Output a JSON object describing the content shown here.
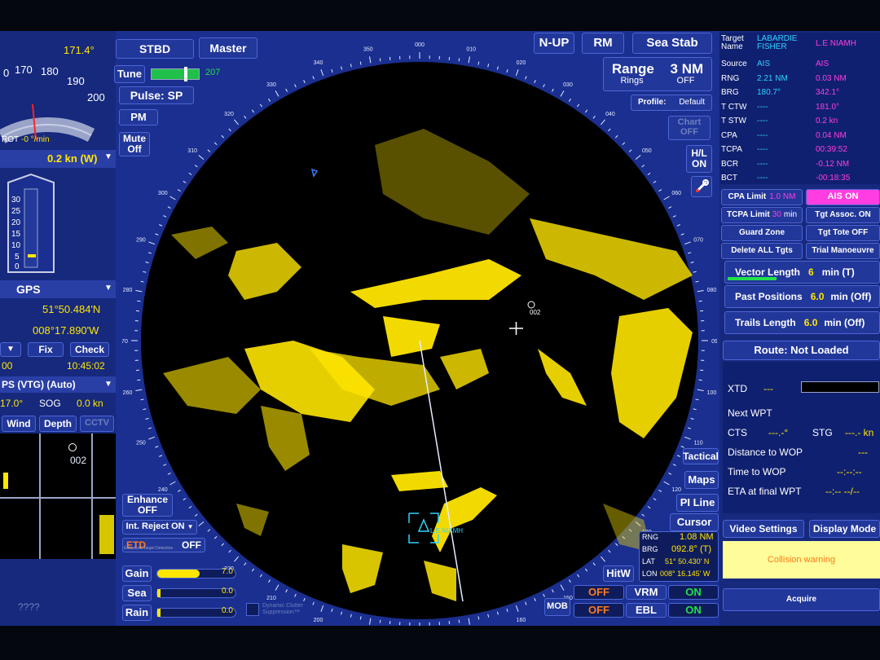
{
  "top_left": {
    "heading_value": "171.4°",
    "scale_labels": [
      "0",
      "170",
      "180",
      "190",
      "200"
    ],
    "rot_label": "ROT",
    "rot_value": "-0 °/min"
  },
  "speed": {
    "value": "0.2 kn (W)"
  },
  "depth_scale": [
    "30",
    "25",
    "20",
    "15",
    "10",
    "5",
    "0"
  ],
  "position": {
    "source": "GPS",
    "lat": "51°50.484'N",
    "lon": "008°17.890'W",
    "fix_label": "Fix",
    "check_label": "Check",
    "time_left": "00",
    "time": "10:45:02"
  },
  "cog": {
    "mode": "PS (VTG) (Auto)",
    "cog_value": "17.0°",
    "sog_label": "SOG",
    "sog_value": "0.0 kn"
  },
  "mini_tabs": [
    "Wind",
    "Depth",
    "CCTV"
  ],
  "mini_target": "002",
  "bottom_left_text": "????",
  "top_buttons": {
    "stbd": "STBD",
    "master": "Master",
    "tune": "Tune",
    "tune_value": "207",
    "pulse": "Pulse: SP",
    "pm": "PM",
    "mute": "Mute Off",
    "nup": "N-UP",
    "rm": "RM",
    "sea_stab": "Sea Stab"
  },
  "range": {
    "label": "Range",
    "value": "3 NM",
    "rings_label": "Rings",
    "rings_value": "OFF",
    "profile_label": "Profile:",
    "profile_value": "Default"
  },
  "chart": {
    "label": "Chart OFF",
    "hl": "H/L ON"
  },
  "radar_bearings": [
    "000",
    "010",
    "020",
    "030",
    "040",
    "050",
    "060",
    "070",
    "080",
    "090",
    "100",
    "110",
    "120",
    "130",
    "140",
    "150",
    "160",
    "170",
    "180",
    "190",
    "200",
    "210",
    "220",
    "230",
    "240",
    "250",
    "260",
    "270",
    "280",
    "290",
    "300",
    "310",
    "320",
    "330",
    "340",
    "350"
  ],
  "radar_targets": {
    "ais_label": "002",
    "own_label": "L.E NIAMH"
  },
  "bottom_controls": {
    "enhance": "Enhance OFF",
    "int_reject": "Int. Reject ON",
    "etd": "ETD",
    "etd_value": "OFF",
    "etd_sub": "Enhanced Target Detection",
    "gain": "Gain",
    "gain_value": "7.0",
    "sea": "Sea",
    "sea_value": "0.0",
    "rain": "Rain",
    "rain_value": "0.0",
    "dcs": "Dynamic Clutter Suppression™"
  },
  "right_radar_buttons": {
    "tactical": "Tactical",
    "maps": "Maps",
    "pi_line": "PI Line",
    "cursor": "Cursor",
    "hitw": "HitW",
    "mob": "MOB"
  },
  "cursor_readout": {
    "rng_label": "RNG",
    "rng": "1.08 NM",
    "brg_label": "BRG",
    "brg": "092.8° (T)",
    "lat_label": "LAT",
    "lat": "51° 50.430' N",
    "lon_label": "LON",
    "lon": "008° 16.145' W"
  },
  "vrm_ebl": {
    "vrm_label": "VRM",
    "ebl_label": "EBL",
    "off": "OFF",
    "on": "ON"
  },
  "target_table": {
    "header": [
      "Target Name",
      "LABARDIE FISHER",
      "L.E NIAMH"
    ],
    "rows": [
      [
        "Source",
        "AIS",
        "AIS"
      ],
      [
        "RNG",
        "2.21 NM",
        "0.03 NM"
      ],
      [
        "BRG",
        "180.7°",
        "342.1°"
      ],
      [
        "T CTW",
        "----",
        "181.0°"
      ],
      [
        "T STW",
        "----",
        "0.2 kn"
      ],
      [
        "CPA",
        "----",
        "0.04 NM"
      ],
      [
        "TCPA",
        "----",
        "00:39:52"
      ],
      [
        "BCR",
        "----",
        "-0.12 NM"
      ],
      [
        "BCT",
        "----",
        "-00:18:35"
      ]
    ]
  },
  "target_controls": {
    "cpa_limit": "CPA Limit",
    "cpa_value": "1.0 NM",
    "ais_on": "AIS ON",
    "tcpa_limit": "TCPA Limit",
    "tcpa_value": "30",
    "tcpa_unit": "min",
    "tgt_assoc": "Tgt Assoc. ON",
    "guard_zone": "Guard Zone",
    "tgt_tote": "Tgt Tote OFF",
    "delete_all": "Delete ALL Tgts",
    "trial": "Trial Manoeuvre"
  },
  "vectors": {
    "vector_label": "Vector Length",
    "vector_value": "6",
    "vector_unit": "min (T)",
    "past_label": "Past Positions",
    "past_value": "6.0",
    "past_unit": "min (Off)",
    "trails_label": "Trails Length",
    "trails_value": "6.0",
    "trails_unit": "min (Off)"
  },
  "route": {
    "title": "Route: Not Loaded",
    "xtd": "XTD",
    "xtd_val": "---",
    "next_wpt": "Next WPT",
    "cts": "CTS",
    "cts_val": "---.-°",
    "stg": "STG",
    "stg_val": "---.- kn",
    "dist_wop": "Distance to WOP",
    "dist_val": "---",
    "time_wop": "Time to WOP",
    "time_val": "--:--:--",
    "eta": "ETA at final WPT",
    "eta_val": "--:-- --/--"
  },
  "bottom_right": {
    "video_settings": "Video Settings",
    "display_mode": "Display Mode",
    "collision": "Collision warning",
    "acquire": "Acquire"
  }
}
